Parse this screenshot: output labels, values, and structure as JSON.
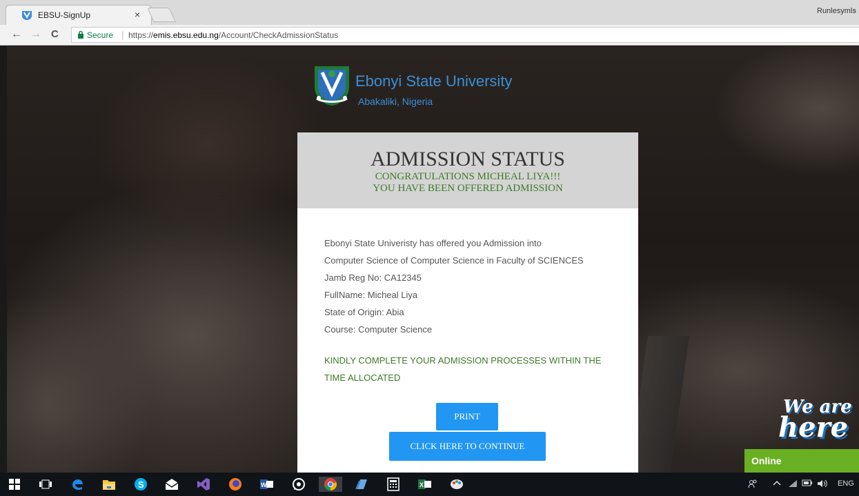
{
  "browser": {
    "tab_title": "EBSU-SignUp",
    "tab_close": "×",
    "profile_name": "Runlesymls",
    "window_dash": "-",
    "nav": {
      "back": "←",
      "forward": "→",
      "reload": "C"
    },
    "secure_label": "Secure",
    "separator": "|",
    "url_scheme": "https://",
    "url_host": "emis.ebsu.edu.ng",
    "url_path": "/Account/CheckAdmissionStatus"
  },
  "header": {
    "university_name": "Ebonyi State University",
    "location": "Abakaliki, Nigeria"
  },
  "card": {
    "title": "ADMISSION STATUS",
    "congrats": "CONGRATULATIONS MICHEAL LIYA!!!",
    "offered": "YOU HAVE BEEN OFFERED ADMISSION",
    "details": [
      "Ebonyi State Univeristy has offered you Admission into",
      "Computer Science of Computer Science in Faculty of SCIENCES",
      "Jamb Reg No: CA12345",
      "FullName: Micheal Liya",
      "State of Origin: Abia",
      "Course: Computer Science"
    ],
    "notice": "KINDLY COMPLETE YOUR ADMISSION PROCESSES WITHIN THE TIME ALLOCATED",
    "print_label": "PRINT",
    "continue_label": "CLICK HERE TO CONTINUE"
  },
  "chat_widget": {
    "line1": "We are",
    "line2": "here",
    "status": "Online"
  },
  "taskbar": {
    "tray_text": "ENG"
  },
  "colors": {
    "accent": "#2196f3",
    "brand_blue": "#3b8fd6",
    "success_green": "#3d7a28",
    "online_green": "#6ab023"
  }
}
